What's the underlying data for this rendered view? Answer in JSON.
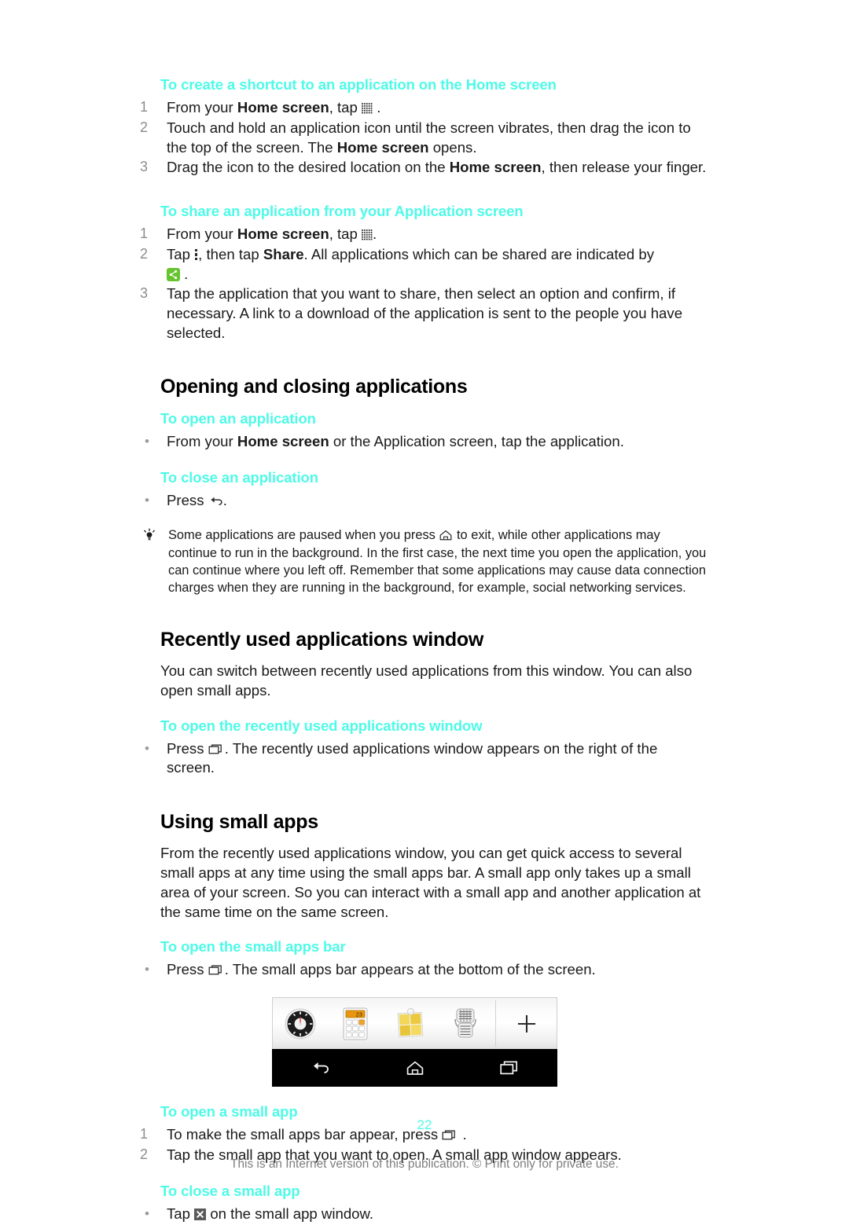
{
  "page": {
    "number": "22",
    "footnote": "This is an Internet version of this publication. © Print only for private use.",
    "accent_color": "#4dfbe7",
    "text_color": "#1a1a1a",
    "footer_color": "#7d7d7d"
  },
  "sections": {
    "shortcut": {
      "heading": "To create a shortcut to an application on the Home screen",
      "steps": [
        {
          "num": "1",
          "pre": "From your ",
          "bold": "Home screen",
          "post": ", tap ",
          "icon": "app-grid-icon",
          "tail": " ."
        },
        {
          "num": "2",
          "pre": "Touch and hold an application icon until the screen vibrates, then drag the icon to the top of the screen. The ",
          "bold": "Home screen",
          "post": " opens.",
          "tail": ""
        },
        {
          "num": "3",
          "pre": "Drag the icon to the desired location on the ",
          "bold": "Home screen",
          "post": ", then release your finger.",
          "tail": ""
        }
      ]
    },
    "share": {
      "heading": "To share an application from your Application screen",
      "steps": [
        {
          "num": "1",
          "pre": "From your ",
          "bold": "Home screen",
          "post": ", tap ",
          "icon": "app-grid-icon",
          "tail": "."
        },
        {
          "num": "2",
          "pre": "Tap ",
          "icon": "overflow-menu-icon",
          "mid": ", then tap ",
          "bold": "Share",
          "post": ". All applications which can be shared are indicated by ",
          "icon2": "share-icon",
          "tail": " ."
        },
        {
          "num": "3",
          "pre": "Tap the application that you want to share, then select an option and confirm, if necessary. A link to a download of the application is sent to the people you have selected.",
          "tail": ""
        }
      ]
    },
    "opening_closing": {
      "heading": "Opening and closing applications",
      "open_app": {
        "heading": "To open an application",
        "pre": "From your ",
        "bold": "Home screen",
        "post": " or the Application screen, tap the application."
      },
      "close_app": {
        "heading": "To close an application",
        "pre": "Press ",
        "icon": "back-arrow-icon",
        "post": "."
      },
      "tip": {
        "icon": "lightbulb-icon",
        "pre": "Some applications are paused when you press ",
        "icon_inline": "home-icon",
        "post": " to exit, while other applications may continue to run in the background. In the first case, the next time you open the application, you can continue where you left off. Remember that some applications may cause data connection charges when they are running in the background, for example, social networking services."
      }
    },
    "recent_apps": {
      "heading": "Recently used applications window",
      "body": "You can switch between recently used applications from this window. You can also open small apps.",
      "open_window": {
        "heading": "To open the recently used applications window",
        "pre": "Press ",
        "icon": "recents-icon",
        "post": ". The recently used applications window appears on the right of the screen."
      }
    },
    "small_apps": {
      "heading": "Using small apps",
      "body": "From the recently used applications window, you can get quick access to several small apps at any time using the small apps bar. A small app only takes up a small area of your screen. So you can interact with a small app and another application at the same time on the same screen.",
      "open_bar": {
        "heading": "To open the small apps bar",
        "pre": "Press ",
        "icon": "recents-icon",
        "post": ". The small apps bar appears at the bottom of the screen."
      },
      "figure": {
        "name": "small-apps-bar-screenshot",
        "apps": [
          {
            "name": "timer-app-icon",
            "label": "Timer"
          },
          {
            "name": "calculator-app-icon",
            "label": "Calculator",
            "display": "23"
          },
          {
            "name": "notes-app-icon",
            "label": "Notes"
          },
          {
            "name": "voice-recorder-app-icon",
            "label": "Voice recorder"
          }
        ],
        "add_button": "+",
        "nav_buttons": [
          {
            "name": "nav-back-icon",
            "label": "Back"
          },
          {
            "name": "nav-home-icon",
            "label": "Home"
          },
          {
            "name": "nav-recents-icon",
            "label": "Recent apps"
          }
        ]
      },
      "open_app": {
        "heading": "To open a small app",
        "steps": [
          {
            "num": "1",
            "pre": "To make the small apps bar appear, press ",
            "icon": "recents-icon",
            "post": " ."
          },
          {
            "num": "2",
            "pre": "Tap the small app that you want to open. A small app window appears.",
            "post": ""
          }
        ]
      },
      "close_app": {
        "heading": "To close a small app",
        "pre": "Tap ",
        "icon": "close-x-icon",
        "post": " on the small app window."
      }
    }
  }
}
